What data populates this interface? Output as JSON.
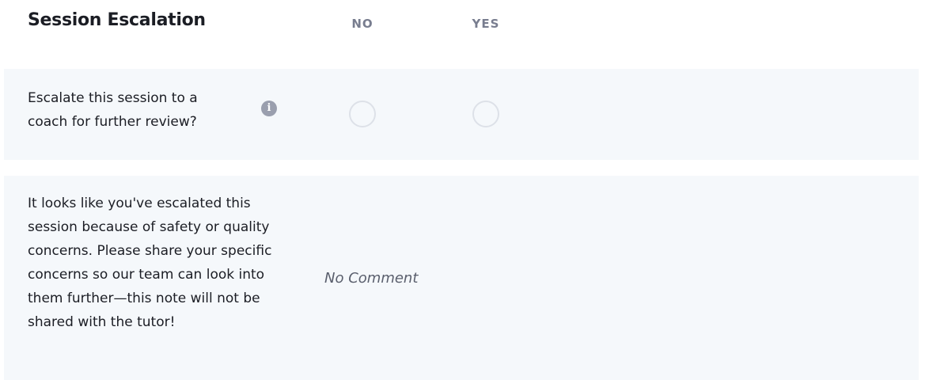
{
  "section": {
    "title": "Session Escalation",
    "columns": [
      "NO",
      "YES"
    ]
  },
  "escalate": {
    "question": "Escalate this session to a coach for further review?",
    "info_icon": "info-icon",
    "selected": null
  },
  "comment": {
    "prompt": "It looks like you've escalated this session because of safety or quality concerns. Please share your specific concerns so our team can look into them further—this note will not be shared with the tutor!",
    "value": "No Comment"
  },
  "colors": {
    "row_background": "#f5f8fb",
    "heading_text": "#1b1d24",
    "column_header_text": "#787d8f",
    "radio_border": "#dde1e8",
    "info_icon_bg": "#9a9fae",
    "muted_text": "#5a5f6d"
  }
}
